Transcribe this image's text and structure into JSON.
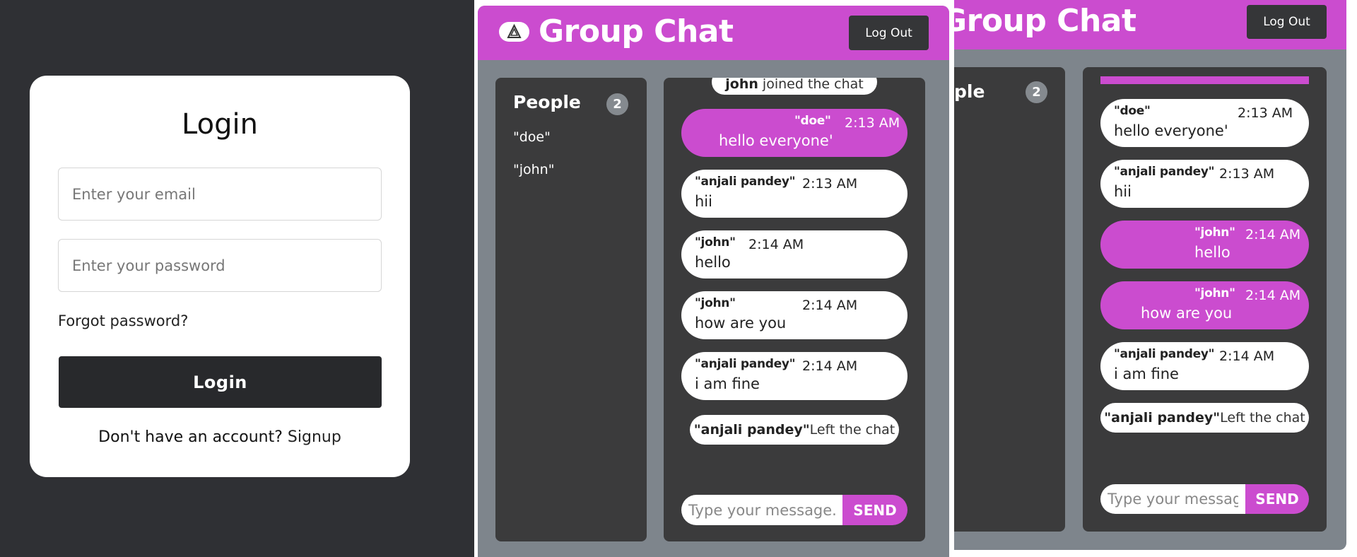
{
  "login": {
    "title": "Login",
    "email_placeholder": "Enter your email",
    "password_placeholder": "Enter your password",
    "forgot_password": "Forgot password?",
    "login_button": "Login",
    "signup_prompt": "Don't have an account?",
    "signup_link": "Signup"
  },
  "chat_a": {
    "title": "Group Chat",
    "logout_label": "Log Out",
    "people_title": "People",
    "people_count": "2",
    "people": [
      "\"doe\"",
      "\"john\""
    ],
    "join_notice": {
      "name": "john",
      "text": " joined the chat"
    },
    "messages": [
      {
        "name": "\"doe\"",
        "time": "2:13 AM",
        "text": "hello everyone'",
        "own": true
      },
      {
        "name": "\"anjali pandey\"",
        "time": "2:13 AM",
        "text": "hii",
        "own": false
      },
      {
        "name": "\"john\"",
        "time": "2:14 AM",
        "text": "hello",
        "own": false
      },
      {
        "name": "\"john\"",
        "time": "2:14 AM",
        "text": "how are you",
        "own": false
      },
      {
        "name": "\"anjali pandey\"",
        "time": "2:14 AM",
        "text": "i am fine",
        "own": false
      }
    ],
    "leave_notice": {
      "name": "\"anjali pandey\"",
      "text": "Left the chat"
    },
    "input_placeholder": "Type your message...",
    "send_label": "SEND"
  },
  "chat_b": {
    "title": "Group Chat",
    "logout_label": "Log Out",
    "people_title": "ple",
    "people_count": "2",
    "messages": [
      {
        "name": "\"doe\"",
        "time": "2:13 AM",
        "text": "hello everyone'",
        "own": false
      },
      {
        "name": "\"anjali pandey\"",
        "time": "2:13 AM",
        "text": "hii",
        "own": false
      },
      {
        "name": "\"john\"",
        "time": "2:14 AM",
        "text": "hello",
        "own": true
      },
      {
        "name": "\"john\"",
        "time": "2:14 AM",
        "text": "how are you",
        "own": true
      },
      {
        "name": "\"anjali pandey\"",
        "time": "2:14 AM",
        "text": "i am fine",
        "own": false
      }
    ],
    "leave_notice": {
      "name": "\"anjali pandey\"",
      "text": "Left the chat"
    },
    "input_placeholder": "Type your message",
    "send_label": "SEND"
  },
  "colors": {
    "background": "#2f3034",
    "accent": "#cb4ccf",
    "panel": "#3b3b3c",
    "chat_body": "#7e858c",
    "login_button": "#28292c"
  }
}
